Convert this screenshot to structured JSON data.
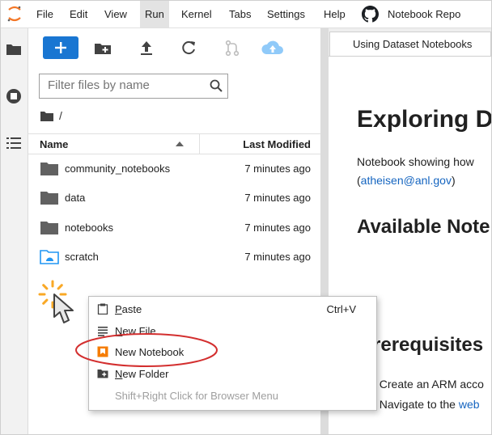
{
  "menubar": {
    "items": [
      "File",
      "Edit",
      "View",
      "Run",
      "Kernel",
      "Tabs",
      "Settings",
      "Help"
    ],
    "active": "Run",
    "repo_link": "Notebook Repo"
  },
  "file_browser": {
    "filter_placeholder": "Filter files by name",
    "breadcrumb": "/",
    "columns": {
      "name": "Name",
      "modified": "Last Modified"
    },
    "rows": [
      {
        "name": "community_notebooks",
        "modified": "7 minutes ago",
        "type": "folder"
      },
      {
        "name": "data",
        "modified": "7 minutes ago",
        "type": "folder"
      },
      {
        "name": "notebooks",
        "modified": "7 minutes ago",
        "type": "folder"
      },
      {
        "name": "scratch",
        "modified": "7 minutes ago",
        "type": "shared-folder"
      }
    ]
  },
  "notebook": {
    "tab_title": "Using Dataset Notebooks",
    "heading": "Exploring D",
    "intro_line1": "Notebook showing how",
    "intro_paren_open": "(",
    "intro_email": "atheisen@anl.gov",
    "intro_paren_close": ")",
    "available_heading": "Available Note",
    "prereq_heading": "rerequisites",
    "step1": ". Create an ARM acco",
    "step2_prefix": ". Navigate to the ",
    "step2_link": "web"
  },
  "context_menu": {
    "items": [
      {
        "label_first": "P",
        "label_rest": "aste",
        "shortcut": "Ctrl+V"
      },
      {
        "label_first": "N",
        "label_rest": "ew File",
        "shortcut": ""
      },
      {
        "label_first": "",
        "label_rest": "New Notebook",
        "shortcut": ""
      },
      {
        "label_first": "N",
        "label_rest": "ew Folder",
        "shortcut": ""
      }
    ],
    "hint": "Shift+Right Click for Browser Menu"
  },
  "colors": {
    "accent_blue": "#1976d2",
    "folder_gray": "#616161",
    "shared_folder_blue": "#2196f3",
    "notebook_orange": "#f57c00",
    "highlight_red": "#d32f2f",
    "link_blue": "#1565c0"
  },
  "icons": [
    "jupyter-logo",
    "github-icon",
    "folder-icon",
    "running-icon",
    "toc-icon",
    "plus-icon",
    "new-folder-icon",
    "upload-icon",
    "refresh-icon",
    "git-icon",
    "cloud-upload-icon",
    "search-icon",
    "spinner-icon",
    "cursor-arrow-icon",
    "paste-icon",
    "new-file-icon",
    "notebook-icon"
  ]
}
